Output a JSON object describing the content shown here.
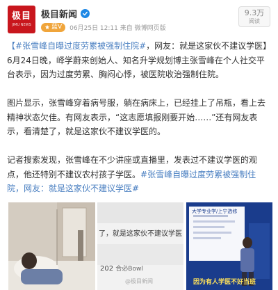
{
  "post": {
    "avatar_text": "极目",
    "avatar_subtext": "JIMU NEWS",
    "author": "极目新闻",
    "tag": "蓝V",
    "meta": "06月25日 12:11 来自 微博网页版",
    "views_count": "9.3万",
    "views_label": "阅读"
  },
  "content": {
    "title_bracket_open": "【",
    "title_topic": "#张雪峰自曝过度劳累被强制住院#",
    "title_rest": "，网友：就是这家伙不建议学医",
    "title_bracket_close": "】",
    "p1": "6月24日晚，峄学蔚来创始人、知名升学规划博主张雪峰在个人社交平台表示，因为过度劳累、胸闷心悸，被医院收治强制住院。",
    "p2": "图片显示，张雪峰穿着病号服，躺在病床上，已经挂上了吊瓶，看上去精神状态欠佳。有网友表示，“这志愿填报刚要开始……”还有网友表示，看清楚了，就是这家伙不建议学医的。",
    "p3_text": "记者搜索发现，张雪峰在不少讲座或直播里，发表过不建议学医的观点，他还特别不建议农村孩子学医。",
    "p3_topic": "#张雪峰自曝过度劳累被强制住院，网友：就是这家伙不建议学医#"
  },
  "images": {
    "mid_caption": "了，就是这家伙不建议学医",
    "mid_stat": "202",
    "mid_stat_suffix": "合必Bowl",
    "mid_watermark": "@极目新闻",
    "right_slide_title": "大学专业学/上宁选修",
    "right_banner": "因为有人学医不好当班"
  },
  "colors": {
    "link": "#4a7fc1",
    "brand_red": "#c8161d",
    "tag_orange": "#f0a53b",
    "verified_blue": "#1e88e5"
  },
  "icons": {
    "verified": "verified-badge-icon",
    "tag": "member-tag-icon"
  }
}
